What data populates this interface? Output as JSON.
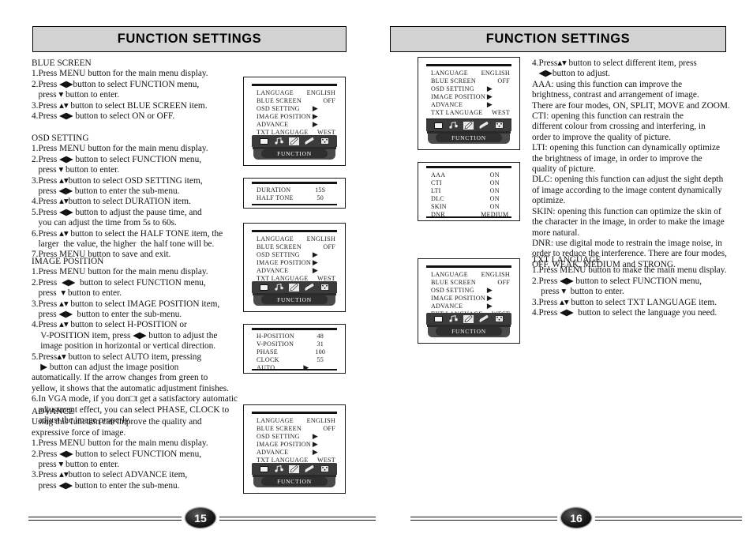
{
  "doc": {
    "banner_title": "FUNCTION SETTINGS",
    "banner_bg": "#d2d2d2"
  },
  "left_page": {
    "page_number": "15",
    "sections": {
      "blue_screen": "BLUE SCREEN\n1.Press MENU button for the main menu display.\n2.Press ◀▶button to select FUNCTION menu,\n   press ▾ button to enter.\n3.Press ▴▾ button to select BLUE SCREEN item.\n4.Press ◀▶ button to select ON or OFF.",
      "osd_setting": "OSD SETTING\n1.Press MENU button for the main menu display.\n2.Press ◀▶ button to select FUNCTION menu,\n   press ▾ button to enter.\n3.Press ▴▾button to select OSD SETTING item,\n   press ◀▶ button to enter the sub-menu.\n4.Press ▴▾button to select DURATION item.\n5.Press ◀▶ button to adjust the pause time, and\n   you can adjust the time from 5s to 60s.\n6.Press ▴▾ button to select the HALF TONE item, the\n   larger  the value, the higher  the half tone will be.\n7.Press MENU button to save and exit.",
      "image_position": "IMAGE POSITION\n1.Press MENU button for the main menu display.\n2.Press  ◀▶  button to select FUNCTION menu,\n   press  ▾ button to enter.\n3.Press ▴▾ button to select IMAGE POSITION item,\n   press ◀▶  button to enter the sub-menu.\n4.Press ▴▾ button to select H-POSITION or\n    V-POSITION item, press ◀▶ button to adjust the\n    image position in horizontal or vertical direction.\n5.Press▴▾ button to select AUTO item, pressing\n    ▶ button can adjust the image position\nautomatically. If the arrow changes from green to\nyellow, it shows that the automatic adjustment finishes.\n6.In VGA mode, if you don□t get a satisfactory automatic\n   adjustment effect, you can select PHASE, CLOCK to\n   adjust the image properly.",
      "advance": "ADVANCE\nUsing this function can improve the quality and\nexpressive force of image.\n1.Press MENU button for the main menu display.\n2.Press ◀▶ button to select FUNCTION menu,\n   press ▾ button to enter.\n3.Press ▴▾button to select ADVANCE item,\n   press ◀▶ button to enter the sub-menu."
    }
  },
  "right_page": {
    "page_number": "16",
    "sections": {
      "advance_cont": "4.Press▴▾ button to select different item, press\n   ◀▶button to adjust.\nAAA: using this function can improve the\nbrightness, contrast and arrangement of image.\nThere are four modes, ON, SPLIT, MOVE and ZOOM.\nCTI: opening this function can restrain the\ndifferent colour from crossing and interfering, in\norder to improve the quality of picture.\nLTI: opening this function can dynamically optimize\nthe brightness of image, in order to improve the\nquality of picture.\nDLC: opening this function can adjust the sight depth\nof image according to the image content dynamically\noptimize.\nSKIN: opening this function can optimize the skin of\nthe character in the image, in order to make the image\nmore natural.\nDNR: use digital mode to restrain the image noise, in\norder to reduce the interference. There are four modes,\nOFF, WEAK, MEDIUM and STRONG.",
      "txt_language": "TXT LANGUAGE\n1.Press MENU button to make the main menu display.\n2.Press ◀▶ button to select FUNCTION menu,\n    press ▾  button to enter.\n3.Press ▴▾ button to select TXT LANGUAGE item.\n4.Press ◀▶  button to select the language you need."
    }
  },
  "osd_panels": {
    "function_main": {
      "footer_label": "FUNCTION",
      "rows": [
        {
          "key": "LANGUAGE",
          "value": "ENGLISH",
          "is_arrow": false
        },
        {
          "key": "BLUE SCREEN",
          "value": "OFF",
          "is_arrow": false
        },
        {
          "key": "OSD SETTING",
          "value": "▶",
          "is_arrow": true
        },
        {
          "key": "IMAGE POSITION",
          "value": "▶",
          "is_arrow": true
        },
        {
          "key": "ADVANCE",
          "value": "▶",
          "is_arrow": true
        },
        {
          "key": "TXT LANGUAGE",
          "value": "WEST",
          "is_arrow": false
        }
      ],
      "icons": [
        "picture-icon",
        "sound-icon",
        "function-icon",
        "setup-icon",
        "system-icon"
      ],
      "selected_icon_index": 2
    },
    "osd_setting_sub": {
      "rows": [
        {
          "key": "DURATION",
          "value": "15S"
        },
        {
          "key": "HALF TONE",
          "value": "50"
        }
      ]
    },
    "image_position_sub": {
      "rows": [
        {
          "key": "H-POSITION",
          "value": "48"
        },
        {
          "key": "V-POSITION",
          "value": "31"
        },
        {
          "key": "PHASE",
          "value": "100"
        },
        {
          "key": "CLOCK",
          "value": "55"
        },
        {
          "key": "AUTO",
          "value": "▶"
        }
      ]
    },
    "advance_sub": {
      "rows": [
        {
          "key": "AAA",
          "value": "ON"
        },
        {
          "key": "CTI",
          "value": "ON"
        },
        {
          "key": "LTI",
          "value": "ON"
        },
        {
          "key": "DLC",
          "value": "ON"
        },
        {
          "key": "SKIN",
          "value": "ON"
        },
        {
          "key": "DNR",
          "value": "MEDIUM"
        }
      ]
    }
  }
}
